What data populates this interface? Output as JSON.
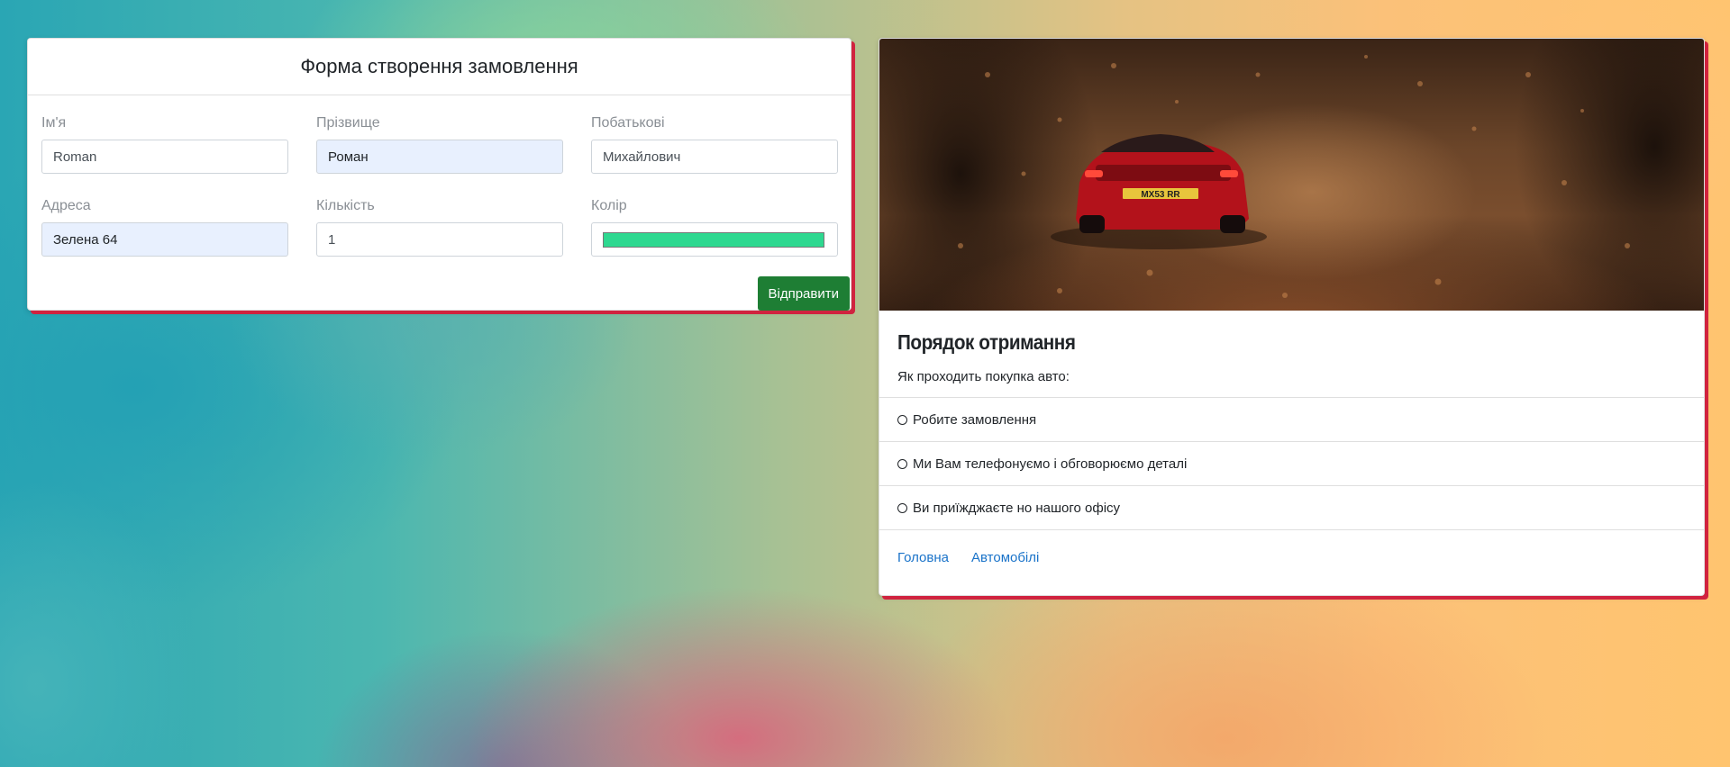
{
  "form": {
    "title": "Форма створення замовлення",
    "fields": {
      "first_name": {
        "label": "Ім'я",
        "value": "Roman"
      },
      "last_name": {
        "label": "Прізвище",
        "value": "Роман"
      },
      "patronymic": {
        "label": "Побатькові",
        "value": "Михайлович"
      },
      "address": {
        "label": "Адреса",
        "value": "Зелена 64"
      },
      "quantity": {
        "label": "Кількість",
        "value": "1"
      },
      "color": {
        "label": "Колір",
        "value": "#2ed890"
      }
    },
    "submit_label": "Відправити",
    "submit_color": "#1e7e34"
  },
  "info": {
    "image_alt": "red sports car on autumn leaves road",
    "title": "Порядок отримання",
    "subtitle": "Як проходить покупка авто:",
    "steps": [
      "Робите замовлення",
      "Ми Вам телефонуємо і обговорюємо деталі",
      "Ви приїжджаєте но нашого офісу"
    ],
    "links": [
      "Головна",
      "Автомобілі"
    ],
    "plate_text": "MX53 RR"
  },
  "colors": {
    "accent_shadow": "#d0233f",
    "link": "#1a73c9"
  }
}
